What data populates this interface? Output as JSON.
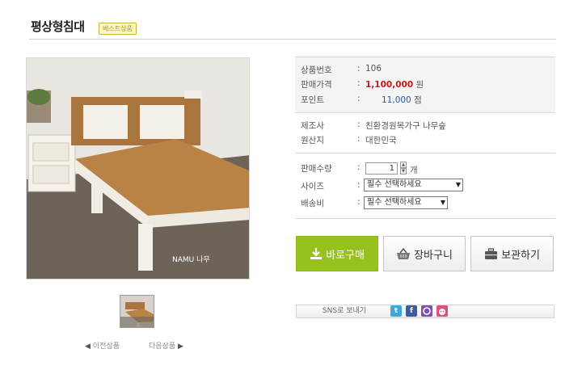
{
  "header": {
    "title": "평상형침대",
    "badge": "베스트상품"
  },
  "product": {
    "code_label": "상품번호",
    "code_value": "106",
    "price_label": "판매가격",
    "price_value": "1,100,000",
    "price_unit": "원",
    "point_label": "포인트",
    "point_value": "11,000",
    "point_unit": "점",
    "maker_label": "제조사",
    "maker_value": "친환경원목가구 나무숲",
    "origin_label": "원산지",
    "origin_value": "대한민국",
    "qty_label": "판매수량",
    "qty_value": "1",
    "qty_unit": "개",
    "size_label": "사이즈",
    "size_select": "필수 선택하세요",
    "ship_label": "배송비",
    "ship_select": "필수 선택하세요",
    "colon": ":"
  },
  "actions": {
    "buy_now": "바로구매",
    "cart": "장바구니",
    "keep": "보관하기"
  },
  "gallery": {
    "prev": "이전상품",
    "next": "다음상품",
    "watermark": "NAMU 나무"
  },
  "sns": {
    "label": "SNS로 보내기",
    "twitter_glyph": "t",
    "facebook_glyph": "f"
  },
  "colors": {
    "accent_green": "#97c11f",
    "price_red": "#c31b1b",
    "point_blue": "#2a56a6"
  },
  "icons": [
    "download-icon",
    "basket-icon",
    "briefcase-icon",
    "twitter-icon",
    "facebook-icon",
    "me2day-icon",
    "yozm-icon",
    "triangle-left-icon",
    "triangle-right-icon",
    "spinner-up-icon",
    "spinner-down-icon",
    "chevron-down-icon"
  ]
}
